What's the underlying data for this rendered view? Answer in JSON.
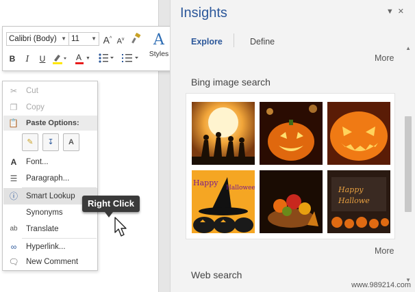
{
  "mini_toolbar": {
    "font_name": "Calibri (Body)",
    "font_size": "11",
    "grow_font": "A",
    "shrink_font": "A",
    "bold": "B",
    "italic": "I",
    "underline": "U",
    "font_color": "A",
    "styles_label": "Styles",
    "styles_glyph": "A"
  },
  "context_menu": {
    "cut": "Cut",
    "copy": "Copy",
    "paste_options": "Paste Options:",
    "font": "Font...",
    "paragraph": "Paragraph...",
    "smart_lookup": "Smart Lookup",
    "synonyms": "Synonyms",
    "translate": "Translate",
    "hyperlink": "Hyperlink...",
    "new_comment": "New Comment"
  },
  "callout": {
    "text": "Right Click"
  },
  "insights": {
    "title": "Insights",
    "tabs": [
      {
        "label": "Explore"
      },
      {
        "label": "Define"
      }
    ],
    "more_top": "More",
    "bing_title": "Bing image search",
    "thumb_texts": {
      "happy_halloween_1": "Happy",
      "happy_halloween_1b": "Halloween",
      "happy_halloween_2": "Happy",
      "happy_halloween_2b": "Hallowe"
    },
    "more_bottom": "More",
    "web_search": "Web search"
  },
  "watermark": "www.989214.com",
  "colors": {
    "accent": "#2b579a",
    "callout_bg": "#3a3a3a",
    "highlight": "#e2e2e2"
  }
}
